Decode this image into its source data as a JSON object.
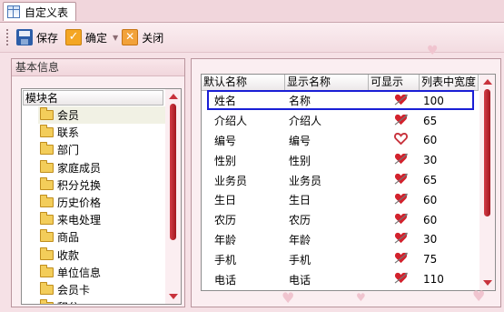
{
  "tab": {
    "title": "自定义表"
  },
  "toolbar": {
    "save_label": "保存",
    "ok_label": "确定",
    "close_label": "关闭"
  },
  "left_panel": {
    "title": "基本信息",
    "column_header": "模块名",
    "items": [
      "会员",
      "联系",
      "部门",
      "家庭成员",
      "积分兑换",
      "历史价格",
      "来电处理",
      "商品",
      "收款",
      "单位信息",
      "会员卡",
      "积分"
    ],
    "selected_index": 0
  },
  "grid": {
    "headers": [
      "默认名称",
      "显示名称",
      "可显示",
      "列表中宽度"
    ],
    "rows": [
      {
        "default_name": "姓名",
        "display_name": "名称",
        "visible_icon": "heart-arrow-icon",
        "width": "100"
      },
      {
        "default_name": "介绍人",
        "display_name": "介绍人",
        "visible_icon": "heart-arrow-icon",
        "width": "65"
      },
      {
        "default_name": "编号",
        "display_name": "编号",
        "visible_icon": "heart-outline-icon",
        "width": "60"
      },
      {
        "default_name": "性别",
        "display_name": "性别",
        "visible_icon": "heart-arrow-icon",
        "width": "30"
      },
      {
        "default_name": "业务员",
        "display_name": "业务员",
        "visible_icon": "heart-arrow-icon",
        "width": "65"
      },
      {
        "default_name": "生日",
        "display_name": "生日",
        "visible_icon": "heart-arrow-icon",
        "width": "60"
      },
      {
        "default_name": "农历",
        "display_name": "农历",
        "visible_icon": "heart-arrow-icon",
        "width": "60"
      },
      {
        "default_name": "年龄",
        "display_name": "年龄",
        "visible_icon": "heart-arrow-icon",
        "width": "30"
      },
      {
        "default_name": "手机",
        "display_name": "手机",
        "visible_icon": "heart-arrow-icon",
        "width": "75"
      },
      {
        "default_name": "电话",
        "display_name": "电话",
        "visible_icon": "heart-arrow-icon",
        "width": "110"
      }
    ],
    "selected_index": 0
  },
  "colors": {
    "accent_red": "#c8323c",
    "selection_blue": "#1a1fd6",
    "background_pink": "#f6e1e6"
  }
}
